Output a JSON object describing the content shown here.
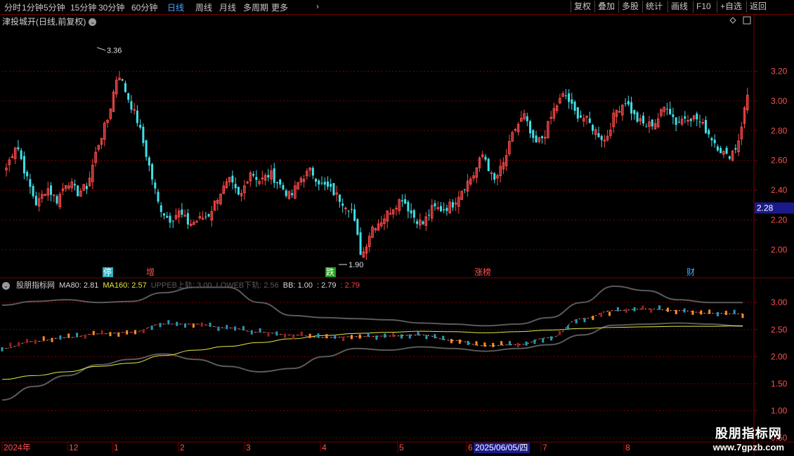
{
  "toolbar": {
    "timeframes": [
      "分时",
      "1分钟",
      "5分钟",
      "15分钟",
      "30分钟",
      "60分钟",
      "日线",
      "周线",
      "月线",
      "多周期",
      "更多"
    ],
    "active_timeframe": "日线",
    "right_buttons": [
      "复权",
      "叠加",
      "多股",
      "统计",
      "画线",
      "F10",
      "+自选",
      "返回"
    ]
  },
  "main_title": "津投城开(日线,前复权)",
  "indicator_title": {
    "name": "股朋指标网",
    "items": [
      {
        "label": "MA80:",
        "value": "2.81",
        "color": "#d8d8d8"
      },
      {
        "label": "MA160:",
        "value": "2.57",
        "color": "#e8e840"
      },
      {
        "label": "UPPEB上轨:",
        "value": "3.00",
        "color": "#5a5a5a"
      },
      {
        "label": "LOWEB下轨:",
        "value": "2.56",
        "color": "#5a5a5a"
      },
      {
        "label": "BB:",
        "value": "1.00",
        "color": "#d8d8d8"
      },
      {
        "label": ":",
        "value": "2.79",
        "color": "#d8d8d8"
      },
      {
        "label": ":",
        "value": "2.79",
        "color": "#ff4040"
      }
    ]
  },
  "chart_data": [
    {
      "type": "candlestick",
      "title": "津投城开(日线,前复权)",
      "ylim": [
        1.82,
        3.5
      ],
      "yticks": [
        "3.20",
        "3.00",
        "2.80",
        "2.60",
        "2.40",
        "2.20",
        "2.00"
      ],
      "y_values": [
        3.2,
        3.0,
        2.8,
        2.6,
        2.4,
        2.2,
        2.0
      ],
      "current_price_label": "2.28",
      "current_price": 2.28,
      "high_annotation": {
        "label": "3.36",
        "value": 3.36
      },
      "low_annotation": {
        "label": "1.90",
        "value": 1.9
      },
      "event_markers": [
        {
          "label": "停",
          "bg": "#2ab0c0",
          "fg": "#ffffff"
        },
        {
          "label": "增",
          "bg": "#000000",
          "fg": "#ff5050"
        },
        {
          "label": "跌",
          "bg": "#1aa01a",
          "fg": "#ffffff"
        },
        {
          "label": "涨榜",
          "bg": "#000000",
          "fg": "#ff5050"
        },
        {
          "label": "财",
          "bg": "#000000",
          "fg": "#4aa3ff"
        }
      ],
      "anchors": [
        2.55,
        2.72,
        2.48,
        2.3,
        2.42,
        2.33,
        2.47,
        2.38,
        2.43,
        2.7,
        2.88,
        3.2,
        3.02,
        2.85,
        2.58,
        2.3,
        2.2,
        2.25,
        2.17,
        2.2,
        2.24,
        2.38,
        2.46,
        2.34,
        2.53,
        2.46,
        2.51,
        2.43,
        2.35,
        2.48,
        2.53,
        2.44,
        2.4,
        2.33,
        2.27,
        1.95,
        2.15,
        2.2,
        2.28,
        2.35,
        2.23,
        2.17,
        2.28,
        2.27,
        2.31,
        2.42,
        2.5,
        2.65,
        2.45,
        2.58,
        2.8,
        2.9,
        2.7,
        2.77,
        2.95,
        3.05,
        2.92,
        2.88,
        2.8,
        2.73,
        2.93,
        3.0,
        2.88,
        2.83,
        2.86,
        2.98,
        2.85,
        2.9,
        2.88,
        2.8,
        2.7,
        2.62,
        2.7,
        3.04
      ]
    },
    {
      "type": "line",
      "title": "股朋指标网",
      "ylim": [
        0.45,
        3.3
      ],
      "yticks": [
        "3.00",
        "2.50",
        "2.00",
        "1.50",
        "1.00",
        "0.50"
      ],
      "y_values": [
        3.0,
        2.5,
        2.0,
        1.5,
        1.0,
        0.5
      ],
      "series": [
        {
          "name": "MA80",
          "color": "#d8d8d8",
          "values": [
            2.15,
            2.28,
            2.35,
            2.42,
            2.45,
            2.6,
            2.6,
            2.53,
            2.45,
            2.4,
            2.35,
            2.37,
            2.38,
            2.4,
            2.3,
            2.2,
            2.22,
            2.35,
            2.7,
            2.85,
            2.88,
            2.85,
            2.8,
            2.79
          ]
        },
        {
          "name": "MA160",
          "color": "#e8e840",
          "values": [
            1.58,
            1.65,
            1.72,
            1.82,
            1.88,
            2.02,
            2.12,
            2.19,
            2.26,
            2.33,
            2.39,
            2.43,
            2.45,
            2.47,
            2.46,
            2.44,
            2.46,
            2.49,
            2.52,
            2.54,
            2.55,
            2.56,
            2.56,
            2.57
          ]
        },
        {
          "name": "UPPEB上轨",
          "color": "#5a5a5a",
          "values": [
            2.95,
            3.02,
            3.05,
            3.0,
            3.02,
            3.18,
            3.28,
            3.28,
            3.0,
            2.76,
            2.72,
            2.7,
            2.68,
            2.62,
            2.6,
            2.57,
            2.6,
            2.72,
            3.0,
            3.3,
            3.22,
            3.05,
            3.0,
            3.0
          ]
        },
        {
          "name": "LOWEB下轨",
          "color": "#5a5a5a",
          "values": [
            1.2,
            1.45,
            1.65,
            1.85,
            1.95,
            2.05,
            1.95,
            1.82,
            1.72,
            1.78,
            2.0,
            2.15,
            2.12,
            2.18,
            2.15,
            2.1,
            2.15,
            2.22,
            2.4,
            2.58,
            2.6,
            2.62,
            2.6,
            2.56
          ]
        }
      ]
    }
  ],
  "date_axis": {
    "labels": [
      "2024年",
      "12",
      "1",
      "2",
      "3",
      "4",
      "5",
      "6",
      "7",
      "8"
    ],
    "cursor_date": "2025/06/05/四"
  },
  "watermark": {
    "line1": "股朋指标网",
    "line2": "www.7gpzb.com"
  }
}
